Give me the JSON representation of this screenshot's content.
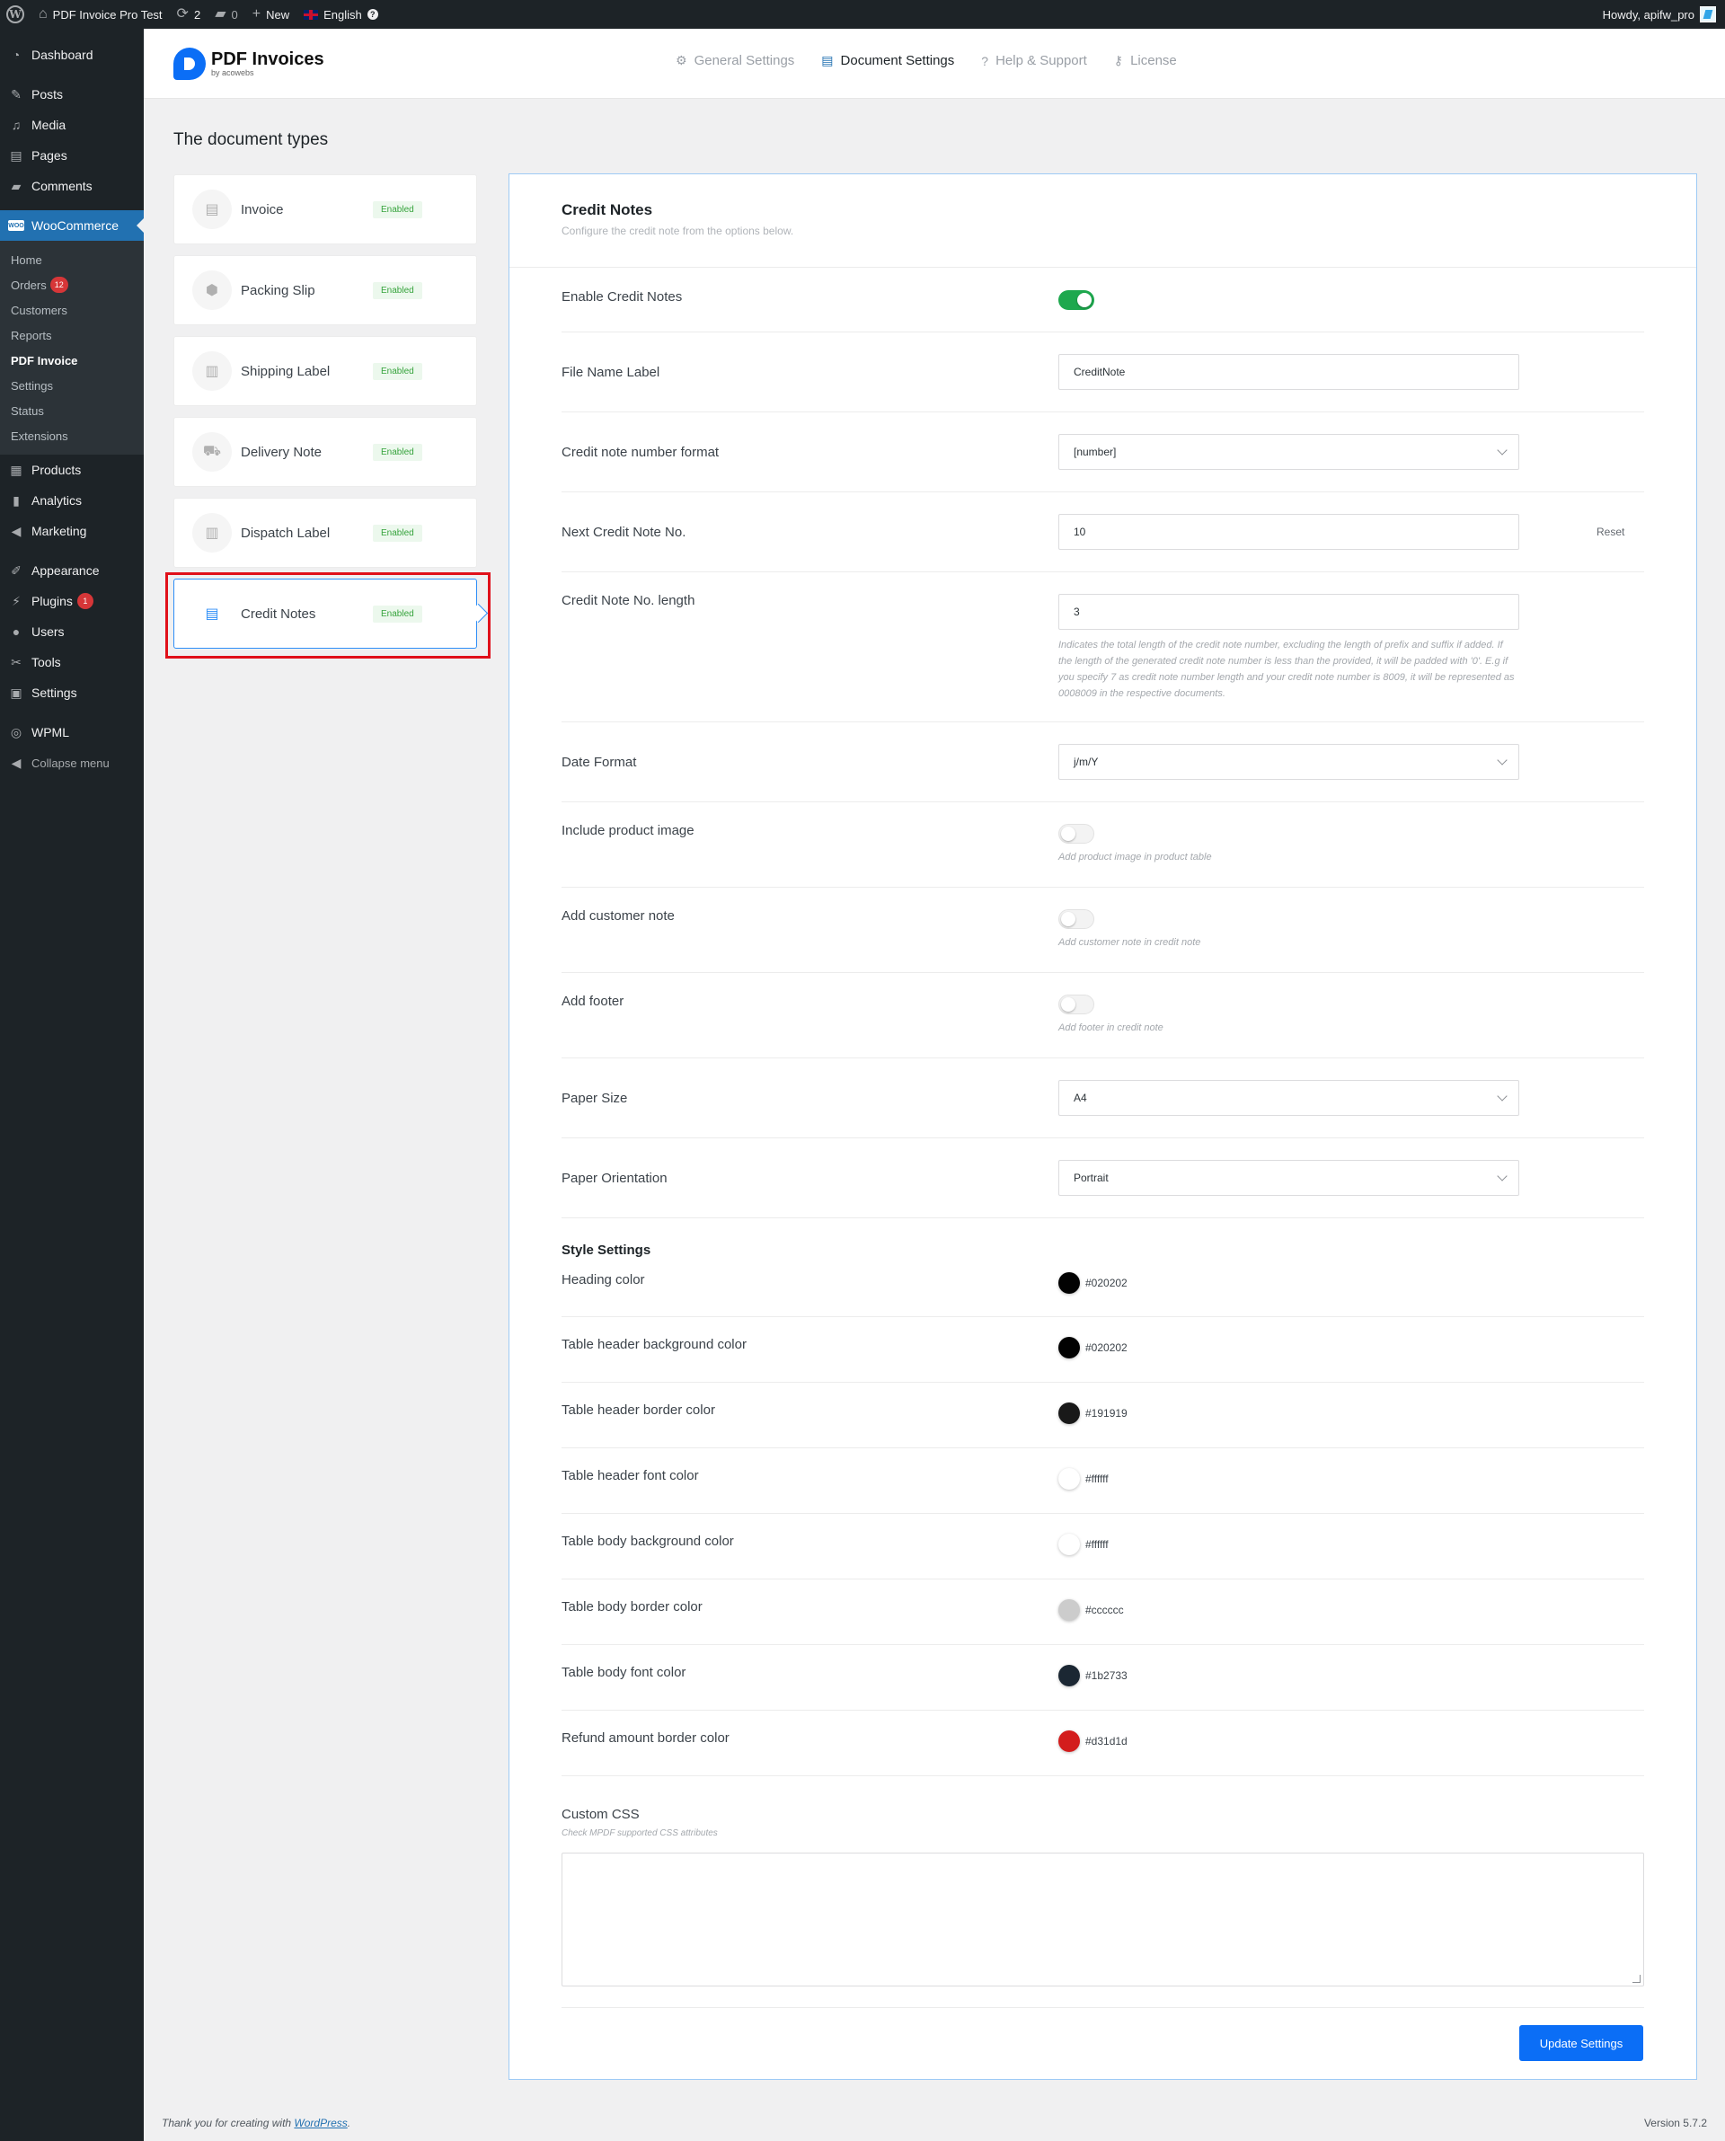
{
  "adminbar": {
    "site_name": "PDF Invoice Pro Test",
    "updates_count": "2",
    "comments_count": "0",
    "new_label": "New",
    "language": "English",
    "greeting": "Howdy, apifw_pro"
  },
  "sidebar": {
    "items": [
      {
        "label": "Dashboard",
        "icon": "dashboard-icon"
      },
      {
        "label": "Posts",
        "icon": "pin-icon"
      },
      {
        "label": "Media",
        "icon": "media-icon"
      },
      {
        "label": "Pages",
        "icon": "page-icon"
      },
      {
        "label": "Comments",
        "icon": "comment-icon"
      },
      {
        "label": "WooCommerce",
        "icon": "woo-icon"
      },
      {
        "label": "Products",
        "icon": "archive-icon"
      },
      {
        "label": "Analytics",
        "icon": "chart-icon"
      },
      {
        "label": "Marketing",
        "icon": "megaphone-icon"
      },
      {
        "label": "Appearance",
        "icon": "brush-icon"
      },
      {
        "label": "Plugins",
        "icon": "plug-icon",
        "badge": "1"
      },
      {
        "label": "Users",
        "icon": "user-icon"
      },
      {
        "label": "Tools",
        "icon": "wrench-icon"
      },
      {
        "label": "Settings",
        "icon": "settings-icon"
      },
      {
        "label": "WPML",
        "icon": "wpml-icon"
      },
      {
        "label": "Collapse menu",
        "icon": "collapse-icon"
      }
    ],
    "woo_submenu": [
      {
        "label": "Home"
      },
      {
        "label": "Orders",
        "badge": "12"
      },
      {
        "label": "Customers"
      },
      {
        "label": "Reports"
      },
      {
        "label": "PDF Invoice"
      },
      {
        "label": "Settings"
      },
      {
        "label": "Status"
      },
      {
        "label": "Extensions"
      }
    ]
  },
  "plugin": {
    "brand_title": "PDF Invoices",
    "brand_sub": "by acowebs",
    "tabs": [
      {
        "label": "General Settings",
        "icon": "gear-icon"
      },
      {
        "label": "Document Settings",
        "icon": "document-icon"
      },
      {
        "label": "Help & Support",
        "icon": "help-icon"
      },
      {
        "label": "License",
        "icon": "key-icon"
      }
    ]
  },
  "doc_types": {
    "title": "The document types",
    "items": [
      {
        "label": "Invoice",
        "status": "Enabled",
        "icon": "invoice-icon"
      },
      {
        "label": "Packing Slip",
        "status": "Enabled",
        "icon": "box-icon"
      },
      {
        "label": "Shipping Label",
        "status": "Enabled",
        "icon": "label-icon"
      },
      {
        "label": "Delivery Note",
        "status": "Enabled",
        "icon": "truck-icon"
      },
      {
        "label": "Dispatch Label",
        "status": "Enabled",
        "icon": "barcode-icon"
      },
      {
        "label": "Credit Notes",
        "status": "Enabled",
        "icon": "document-icon"
      }
    ]
  },
  "panel": {
    "title": "Credit Notes",
    "subtitle": "Configure the credit note from the options below.",
    "enable_label": "Enable Credit Notes",
    "file_name_label": "File Name Label",
    "file_name_value": "CreditNote",
    "number_format_label": "Credit note number format",
    "number_format_value": "[number]",
    "next_no_label": "Next Credit Note No.",
    "next_no_value": "10",
    "reset_label": "Reset",
    "length_label": "Credit Note No. length",
    "length_value": "3",
    "length_help": "Indicates the total length of the credit note number, excluding the length of prefix and suffix if added. If the length of the generated credit note number is less than the provided, it will be padded with '0'. E.g if you specify 7 as credit note number length and your credit note number is 8009, it will be represented as 0008009 in the respective documents.",
    "date_format_label": "Date Format",
    "date_format_value": "j/m/Y",
    "product_image_label": "Include product image",
    "product_image_help": "Add product image in product table",
    "customer_note_label": "Add customer note",
    "customer_note_help": "Add customer note in credit note",
    "footer_label": "Add footer",
    "footer_help": "Add footer in credit note",
    "paper_size_label": "Paper Size",
    "paper_size_value": "A4",
    "orientation_label": "Paper Orientation",
    "orientation_value": "Portrait",
    "style_title": "Style Settings",
    "colors": [
      {
        "label": "Heading color",
        "value": "#020202"
      },
      {
        "label": "Table header background color",
        "value": "#020202"
      },
      {
        "label": "Table header border color",
        "value": "#191919"
      },
      {
        "label": "Table header font color",
        "value": "#ffffff"
      },
      {
        "label": "Table body background color",
        "value": "#ffffff"
      },
      {
        "label": "Table body border color",
        "value": "#cccccc"
      },
      {
        "label": "Table body font color",
        "value": "#1b2733"
      },
      {
        "label": "Refund amount border color",
        "value": "#d31d1d"
      }
    ],
    "custom_css_label": "Custom CSS",
    "custom_css_help": "Check MPDF supported CSS attributes",
    "update_button": "Update Settings"
  },
  "footer": {
    "thanks_prefix": "Thank you for creating with ",
    "thanks_link": "WordPress",
    "thanks_suffix": ".",
    "version": "Version 5.7.2"
  }
}
